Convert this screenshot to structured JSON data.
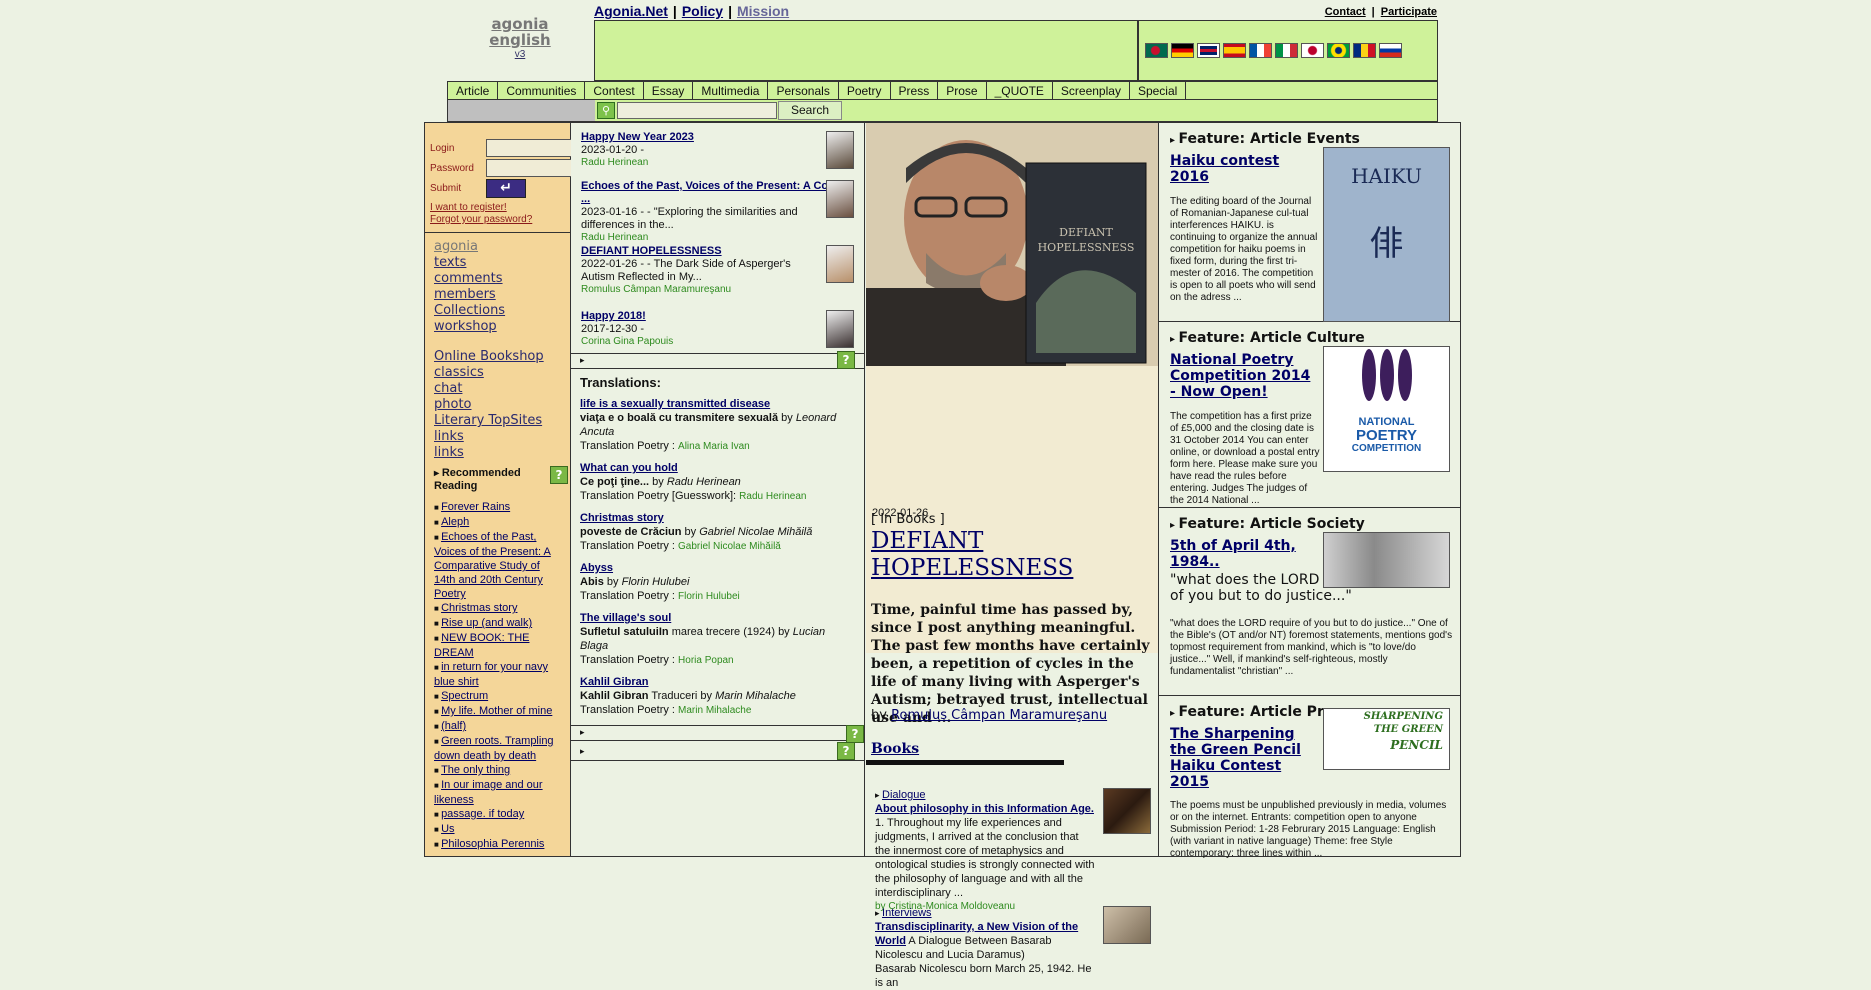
{
  "logo": {
    "line1": "agonia",
    "line2": "english",
    "version": "v3"
  },
  "topnav": {
    "home": "Agonia.Net",
    "policy": "Policy",
    "mission": "Mission",
    "sep": "|"
  },
  "toplinks": {
    "contact": "Contact",
    "participate": "Participate",
    "sep": "|"
  },
  "flags": [
    "bangladesh",
    "germany",
    "uk",
    "spain",
    "france",
    "italy",
    "japan",
    "brazil",
    "romania",
    "russia"
  ],
  "menu": [
    "Article",
    "Communities",
    "Contest",
    "Essay",
    "Multimedia",
    "Personals",
    "Poetry",
    "Press",
    "Prose",
    "_QUOTE",
    "Screenplay",
    "Special"
  ],
  "search": {
    "button": "Search",
    "placeholder": ""
  },
  "login": {
    "login_label": "Login",
    "password_label": "Password",
    "submit_label": "Submit",
    "register": "I want to register!",
    "forgot": "Forgot your password?"
  },
  "sidebar": {
    "links1": [
      "agonia",
      "texts",
      "comments",
      "members",
      "Collections",
      "workshop"
    ],
    "links2": [
      "Online Bookshop",
      "classics",
      "chat",
      "photo",
      "Literary TopSites",
      "links",
      "links"
    ],
    "rec_title": "Recommended Reading",
    "rec_items": [
      "Forever Rains",
      "Aleph",
      "Echoes of the Past, Voices of the Present: A Comparative Study of 14th and 20th Century Poetry",
      "Christmas story",
      "Rise up (and walk)",
      "NEW BOOK: THE DREAM",
      "in return for your navy blue shirt",
      "Spectrum",
      "My life. Mother of mine",
      "(half)",
      "Green roots. Trampling down death by death",
      "The only thing",
      "In our image and our likeness",
      "passage. if today",
      "Us",
      "Philosophia Perennis"
    ]
  },
  "news": [
    {
      "title": "Happy New Year 2023",
      "meta": "2023-01-20 -",
      "author": "Radu Herinean"
    },
    {
      "title": "Echoes of the Past, Voices of the Present: A Compa ...",
      "meta": "2023-01-16 - - \"Exploring the similarities and differences in the...",
      "author": "Radu Herinean"
    },
    {
      "title": "DEFIANT HOPELESSNESS",
      "meta": "2022-01-26 - - The Dark Side of Asperger's Autism Reflected in My...",
      "author": "Romulus Câmpan Maramureşanu"
    },
    {
      "title": "Happy 2018!",
      "meta": "2017-12-30 -",
      "author": "Corina Gina Papouis"
    }
  ],
  "translations": {
    "title": "Translations:",
    "items": [
      {
        "title": "life is a sexually transmitted disease",
        "orig": "viaţa e o boală cu transmitere sexuală",
        "by": "by",
        "orig_author": "Leonard Ancuta",
        "cat": "Translation Poetry :",
        "translator": "Alina Maria Ivan"
      },
      {
        "title": "What can you hold",
        "orig": "Ce poţi ţine...",
        "by": "by",
        "orig_author": "Radu Herinean",
        "cat": "Translation Poetry [Guesswork]:",
        "translator": "Radu Herinean"
      },
      {
        "title": "Christmas story",
        "orig": "poveste de Crăciun",
        "by": "by",
        "orig_author": "Gabriel Nicolae Mihăilă",
        "cat": "Translation Poetry :",
        "translator": "Gabriel Nicolae Mihăilă"
      },
      {
        "title": "Abyss",
        "orig": "Abis",
        "by": "by",
        "orig_author": "Florin Hulubei",
        "cat": "Translation Poetry :",
        "translator": "Florin Hulubei"
      },
      {
        "title": "The village's soul",
        "orig": "Sufletul satuluiIn",
        "orig_rest": "marea trecere (1924) by",
        "by": "",
        "orig_author": "Lucian Blaga",
        "cat": "Translation Poetry :",
        "translator": "Horia Popan"
      },
      {
        "title": "Kahlil Gibran",
        "orig": "Kahlil Gibran",
        "orig_rest": "Traduceri by",
        "by": "",
        "orig_author": "Marin Mihalache",
        "cat": "Translation Poetry :",
        "translator": "Marin Mihalache"
      }
    ]
  },
  "featured": {
    "date": "2022-01-26",
    "category": "[ In Books ]",
    "title": "DEFIANT HOPELESSNESS",
    "desc": "Time, painful time has passed by, since I post anything meaningful. The past few months have certainly been, a repetition of cycles in the life of many living with Asperger's Autism; betrayed trust, intellectual use and ...",
    "by": "by",
    "author": "Romulus Câmpan Maramureşanu",
    "section": "Books"
  },
  "articles": [
    {
      "kind": "Dialogue",
      "title": "About philosophy in this Information Age.",
      "text": "1. Throughout my life experiences and judgments, I arrived at the conclusion that the innermost core of metaphysics and ontological studies is strongly connected with the philosophy of language and with all the interdisciplinary ...",
      "author": "by Cristina-Monica Moldoveanu"
    },
    {
      "kind": "Interviews",
      "title": "Transdisciplinarity, a New Vision of the World",
      "after": "A Dialogue Between Basarab Nicolescu and Lucia Daramus)",
      "text": "Basarab Nicolescu born March 25, 1942. He is an",
      "author": ""
    }
  ],
  "features": [
    {
      "header": "Feature: Article Events",
      "title": "Haiku contest 2016",
      "text": "The editing board of the Journal of Romanian-Japanese cul-tual interferences HAIKU. is continuing to organize the annual competition for haiku poems in fixed form, during the first tri-mester of 2016. The competition is open to all poets who will send on the adress ...",
      "img_word": "HAIKU"
    },
    {
      "header": "Feature: Article Culture",
      "title": "National Poetry Competition 2014 - Now Open!",
      "text": "The competition has a first prize of £5,000 and the closing date is 31 October 2014 You can enter online, or download a postal entry form here. Please make sure you have read the rules before entering. Judges The judges of the 2014 National ...",
      "img_word1": "NATIONAL",
      "img_word2": "POETRY",
      "img_word3": "COMPETITION"
    },
    {
      "header": "Feature: Article Society",
      "title": "5th of April 4th, 1984..",
      "quote": "\"what does the LORD require of you but to do justice...\"",
      "text": "\"what does the LORD require of you but to do justice...\" One of the Bible's (OT and/or NT) foremost statements, mentions god's topmost requirement from mankind, which is \"to love/do justice...\" Well, if mankind's self-righteous, mostly fundamentalist \"christian\" ..."
    },
    {
      "header": "Feature: Article Press",
      "title": "The Sharpening the Green Pencil Haiku Contest 2015",
      "text": "The poems must be unpublished previously in media, volumes or on the internet. Entrants: competition open to anyone Submission Period: 1-28 Februrary 2015 Language: English (with variant in native language) Theme: free Style contemporary: three lines within ...",
      "img_word1": "SHARPENING",
      "img_word2": "THE GREEN",
      "img_word3": "PENCIL"
    }
  ]
}
